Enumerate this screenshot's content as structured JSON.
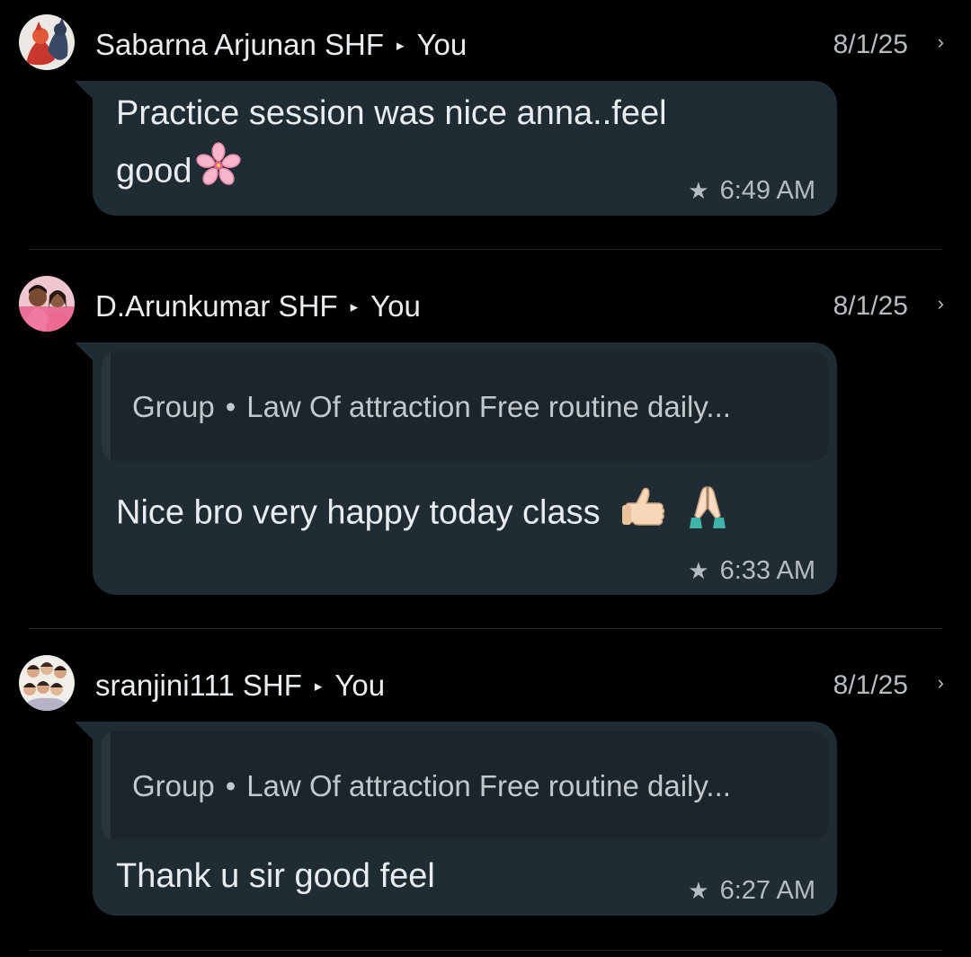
{
  "messages": [
    {
      "sender": "Sabarna Arjunan SHF",
      "recipient": "You",
      "date": "8/1/25",
      "text_line1": "Practice session was nice anna..feel",
      "text_line2": "good",
      "emoji": "cherry-blossom-emoji",
      "time": "6:49 AM",
      "starred": true
    },
    {
      "sender": "D.Arunkumar SHF",
      "recipient": "You",
      "date": "8/1/25",
      "quote_label": "Group",
      "quote_title": "Law Of attraction Free routine daily...",
      "text": "Nice bro very happy today class",
      "emojis": [
        "thumbs-up-emoji",
        "folded-hands-emoji"
      ],
      "time": "6:33 AM",
      "starred": true
    },
    {
      "sender": "sranjini111 SHF",
      "recipient": "You",
      "date": "8/1/25",
      "quote_label": "Group",
      "quote_title": "Law Of attraction Free routine daily...",
      "text": "Thank u sir good feel",
      "time": "6:27 AM",
      "starred": true
    }
  ],
  "icons": {
    "star": "star-icon",
    "chevron": "chevron-right-icon",
    "arrow": "arrow-right-icon"
  },
  "colors": {
    "background": "#000000",
    "bubble": "#202c33",
    "text": "#e9edef",
    "secondary_text": "#b5bcc0"
  }
}
